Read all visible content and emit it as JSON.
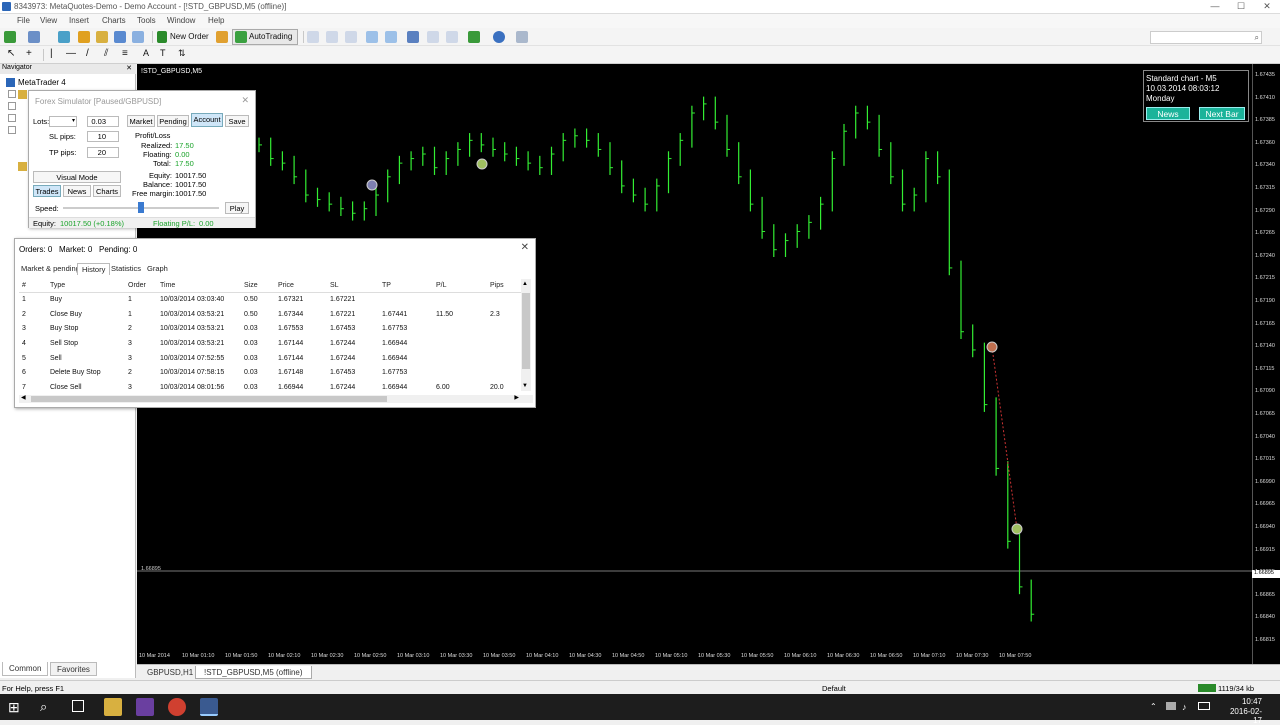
{
  "window": {
    "title": "8343973: MetaQuotes-Demo - Demo Account - [!STD_GBPUSD,M5 (offline)]",
    "min": "—",
    "max": "☐",
    "close": "✕"
  },
  "menu": [
    "File",
    "View",
    "Insert",
    "Charts",
    "Tools",
    "Window",
    "Help"
  ],
  "toolbar": {
    "new_order": "New Order",
    "autotrading": "AutoTrading"
  },
  "navigator": {
    "header": "Navigator",
    "root": "MetaTrader 4",
    "tabs": [
      "Common",
      "Favorites"
    ]
  },
  "forex_simulator": {
    "title": "Forex Simulator [Paused/GBPUSD]",
    "lots_label": "Lots:",
    "lots_value": "0.03",
    "sl_label": "SL pips:",
    "sl_value": "10",
    "tp_label": "TP pips:",
    "tp_value": "20",
    "tabs": [
      "Market",
      "Pending",
      "Account",
      "Save"
    ],
    "active_tab": "Account",
    "profit_loss_label": "Profit/Loss",
    "realized_label": "Realized:",
    "realized": "17.50",
    "floating_label": "Floating:",
    "floating": "0.00",
    "total_label": "Total:",
    "total": "17.50",
    "equity_label": "Equity:",
    "equity": "10017.50",
    "balance_label": "Balance:",
    "balance": "10017.50",
    "free_margin_label": "Free margin:",
    "free_margin": "10017.50",
    "visual_mode": "Visual Mode",
    "subtabs": [
      "Trades",
      "News",
      "Charts"
    ],
    "speed_label": "Speed:",
    "speed_fraction": 0.5,
    "play": "Play",
    "footer_equity_label": "Equity:",
    "footer_equity": "10017.50 (+0.18%)",
    "footer_floating_label": "Floating P/L:",
    "footer_floating": "0.00"
  },
  "trade_window": {
    "summary": "Orders: 0   Market: 0   Pending: 0",
    "close": "✕",
    "tabs": [
      "Market & pending",
      "History",
      "Statistics",
      "Graph"
    ],
    "active_tab": "History",
    "columns": [
      "#",
      "Type",
      "Order",
      "Time",
      "Size",
      "Price",
      "SL",
      "TP",
      "P/L",
      "Pips"
    ],
    "rows": [
      [
        "1",
        "Buy",
        "1",
        "10/03/2014 03:03:40",
        "0.50",
        "1.67321",
        "1.67221",
        "",
        "",
        ""
      ],
      [
        "2",
        "Close Buy",
        "1",
        "10/03/2014 03:53:21",
        "0.50",
        "1.67344",
        "1.67221",
        "1.67441",
        "11.50",
        "2.3"
      ],
      [
        "3",
        "Buy Stop",
        "2",
        "10/03/2014 03:53:21",
        "0.03",
        "1.67553",
        "1.67453",
        "1.67753",
        "",
        ""
      ],
      [
        "4",
        "Sell Stop",
        "3",
        "10/03/2014 03:53:21",
        "0.03",
        "1.67144",
        "1.67244",
        "1.66944",
        "",
        ""
      ],
      [
        "5",
        "Sell",
        "3",
        "10/03/2014 07:52:55",
        "0.03",
        "1.67144",
        "1.67244",
        "1.66944",
        "",
        ""
      ],
      [
        "6",
        "Delete Buy Stop",
        "2",
        "10/03/2014 07:58:15",
        "0.03",
        "1.67148",
        "1.67453",
        "1.67753",
        "",
        ""
      ],
      [
        "7",
        "Close Sell",
        "3",
        "10/03/2014 08:01:56",
        "0.03",
        "1.66944",
        "1.67244",
        "1.66944",
        "6.00",
        "20.0"
      ]
    ]
  },
  "chart": {
    "symbol_label": "!STD_GBPUSD,M5",
    "info_line1": "Standard chart - M5",
    "info_line2": "10.03.2014      08:03:12",
    "info_line3": "Monday",
    "news_button": "News",
    "next_bar_button": "Next Bar",
    "hline_label": "1.66895",
    "bid_label": "1.66895",
    "price_ticks": [
      "1.67435",
      "1.67410",
      "1.67385",
      "1.67360",
      "1.67340",
      "1.67315",
      "1.67290",
      "1.67265",
      "1.67240",
      "1.67215",
      "1.67190",
      "1.67165",
      "1.67140",
      "1.67115",
      "1.67090",
      "1.67065",
      "1.67040",
      "1.67015",
      "1.66990",
      "1.66965",
      "1.66940",
      "1.66915",
      "1.66895",
      "1.66865",
      "1.66840",
      "1.66815"
    ],
    "time_ticks": [
      "10 Mar 2014",
      "10 Mar 01:10",
      "10 Mar 01:50",
      "10 Mar 02:10",
      "10 Mar 02:30",
      "10 Mar 02:50",
      "10 Mar 03:10",
      "10 Mar 03:30",
      "10 Mar 03:50",
      "10 Mar 04:10",
      "10 Mar 04:30",
      "10 Mar 04:50",
      "10 Mar 05:10",
      "10 Mar 05:30",
      "10 Mar 05:50",
      "10 Mar 06:10",
      "10 Mar 06:30",
      "10 Mar 06:50",
      "10 Mar 07:10",
      "10 Mar 07:30",
      "10 Mar 07:50"
    ],
    "tabs": [
      "GBPUSD,H1",
      "!STD_GBPUSD,M5 (offline)"
    ],
    "active_tab": "!STD_GBPUSD,M5 (offline)",
    "bars": [
      1.67355,
      1.6734,
      1.67335,
      1.6732,
      1.673,
      1.67295,
      1.6729,
      1.67285,
      1.6728,
      1.67285,
      1.673,
      1.6732,
      1.67335,
      1.6734,
      1.67345,
      1.6733,
      1.6734,
      1.6735,
      1.6736,
      1.67355,
      1.6735,
      1.67345,
      1.6734,
      1.67335,
      1.6733,
      1.67345,
      1.6736,
      1.67365,
      1.6736,
      1.6735,
      1.6733,
      1.6731,
      1.673,
      1.6729,
      1.6731,
      1.6734,
      1.6736,
      1.6739,
      1.674,
      1.6738,
      1.6735,
      1.6732,
      1.6729,
      1.6726,
      1.6724,
      1.6725,
      1.6726,
      1.6727,
      1.6729,
      1.6734,
      1.6737,
      1.6739,
      1.6738,
      1.6735,
      1.6732,
      1.6729,
      1.673,
      1.6734,
      1.6732,
      1.6722,
      1.6715,
      1.6713,
      1.6707,
      1.67,
      1.6692,
      1.6687,
      1.6684
    ]
  },
  "status": {
    "help": "For Help, press F1",
    "profile": "Default",
    "traffic": "1119/34 kb"
  },
  "taskbar": {
    "time": "10:47",
    "date": "2016-02-17"
  }
}
